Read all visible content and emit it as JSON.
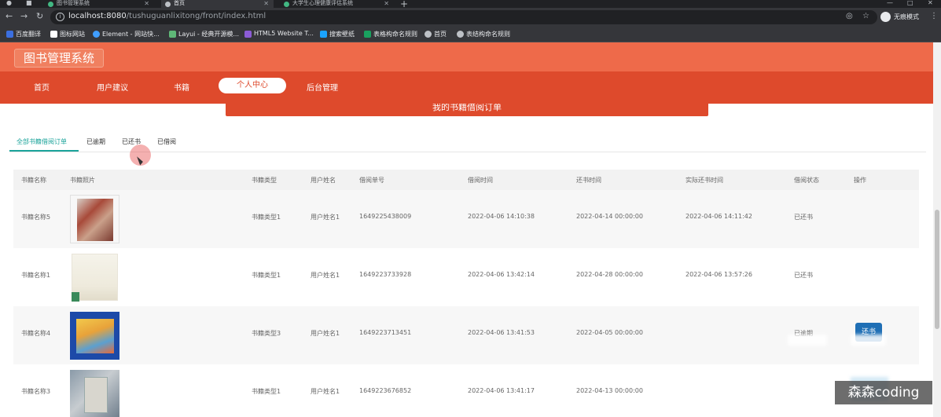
{
  "browser": {
    "tabs": [
      {
        "label": "图书管理系统",
        "active": false
      },
      {
        "label": "首页",
        "active": true
      },
      {
        "label": "大学生心理健康评估系统",
        "active": false
      }
    ],
    "new_tab": "+",
    "url_host": "localhost:8080",
    "url_path": "/tushuguanlixitong/front/index.html",
    "profile_label": "无痕模式",
    "bookmarks": [
      {
        "label": "百度翻译",
        "color": "#3b6fe0"
      },
      {
        "label": "图标网站",
        "color": "#ffffff"
      },
      {
        "label": "Element - 网站快...",
        "color": "#409eff"
      },
      {
        "label": "Layui - 经典开源模...",
        "color": "#5fb878"
      },
      {
        "label": "HTML5 Website T...",
        "color": "#8c5cd6"
      },
      {
        "label": "搜索壁纸",
        "color": "#1aa3ff"
      },
      {
        "label": "表格构命名规则",
        "color": "#19a15f"
      },
      {
        "label": "首页",
        "color": "#bdc1c6"
      },
      {
        "label": "表结构命名规则",
        "color": "#bdc1c6"
      }
    ]
  },
  "site": {
    "logo": "图书管理系统",
    "nav": [
      "首页",
      "用户建议",
      "书籍",
      "个人中心",
      "后台管理"
    ],
    "active_nav": "个人中心",
    "panel_title": "我的书籍借阅订单"
  },
  "subtabs": [
    "全部书籍借阅订单",
    "已逾期",
    "已还书",
    "已借阅"
  ],
  "active_subtab": "全部书籍借阅订单",
  "table": {
    "headers": [
      "书籍名称",
      "书籍照片",
      "书籍类型",
      "用户姓名",
      "借阅单号",
      "借阅时间",
      "还书时间",
      "实际还书时间",
      "借阅状态",
      "操作"
    ],
    "rows": [
      {
        "name": "书籍名称5",
        "type": "书籍类型1",
        "user": "用户姓名1",
        "order": "1649225438009",
        "borrow": "2022-04-06 14:10:38",
        "due": "2022-04-14 00:00:00",
        "returned": "2022-04-06 14:11:42",
        "status": "已还书",
        "action": ""
      },
      {
        "name": "书籍名称1",
        "type": "书籍类型1",
        "user": "用户姓名1",
        "order": "1649223733928",
        "borrow": "2022-04-06 13:42:14",
        "due": "2022-04-28 00:00:00",
        "returned": "2022-04-06 13:57:26",
        "status": "已还书",
        "action": ""
      },
      {
        "name": "书籍名称4",
        "type": "书籍类型3",
        "user": "用户姓名1",
        "order": "1649223713451",
        "borrow": "2022-04-06 13:41:53",
        "due": "2022-04-05 00:00:00",
        "returned": "",
        "status": "已逾期",
        "action": "还书"
      },
      {
        "name": "书籍名称3",
        "type": "书籍类型1",
        "user": "用户姓名1",
        "order": "1649223676852",
        "borrow": "2022-04-06 13:41:17",
        "due": "2022-04-13 00:00:00",
        "returned": "",
        "status": "",
        "action": ""
      }
    ]
  },
  "watermark": "森森coding",
  "colors": {
    "header": "#ee6a4a",
    "nav": "#de4a2c",
    "accent": "#1aa39a",
    "button": "#1f6fb5"
  }
}
